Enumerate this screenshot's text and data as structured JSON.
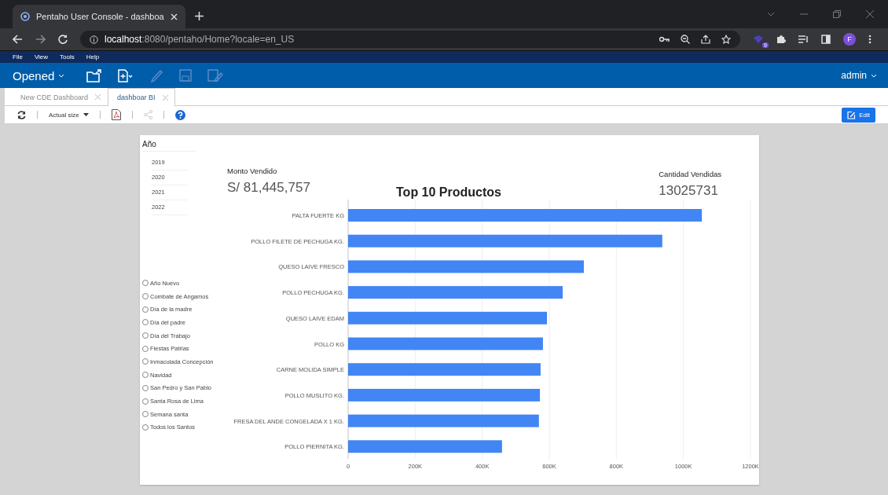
{
  "browser": {
    "tab_title": "Pentaho User Console - dashboa",
    "url_host": "localhost",
    "url_rest": ":8080/pentaho/Home?locale=en_US",
    "extension_badge": "9",
    "profile_initial": "F"
  },
  "menu": [
    "File",
    "View",
    "Tools",
    "Help"
  ],
  "toolbar": {
    "perspective": "Opened",
    "user": "admin"
  },
  "tabs": [
    {
      "label": "New CDE Dashboard",
      "selected": false
    },
    {
      "label": "dashboar BI",
      "selected": true
    }
  ],
  "viewer": {
    "zoom": "Actual size",
    "edit_button": "Edit"
  },
  "dashboard": {
    "year_filter": {
      "title": "Año",
      "years": [
        {
          "label": "2019",
          "selected": false
        },
        {
          "label": "2020",
          "selected": false
        },
        {
          "label": "2021",
          "selected": false
        },
        {
          "label": "2022",
          "selected": false
        }
      ]
    },
    "holidays": [
      {
        "label": "Año Nuevo",
        "selected": false
      },
      {
        "label": "Combate de Angamos",
        "selected": false
      },
      {
        "label": "Día de la madre",
        "selected": false
      },
      {
        "label": "Día del padre",
        "selected": false
      },
      {
        "label": "Día del Trabajo",
        "selected": false
      },
      {
        "label": "Fiestas Patrias",
        "selected": false
      },
      {
        "label": "Inmaculada Concepción",
        "selected": false
      },
      {
        "label": "Navidad",
        "selected": false
      },
      {
        "label": "San Pedro y San Pablo",
        "selected": false
      },
      {
        "label": "Santa Rosa de Lima",
        "selected": false
      },
      {
        "label": "Semana santa",
        "selected": false
      },
      {
        "label": "Todos los Santos",
        "selected": false
      }
    ],
    "kpis": [
      {
        "label": "Monto Vendido",
        "value": "S/ 81,445,757"
      },
      {
        "label": "Cantidad Vendidas",
        "value": "13025731"
      }
    ],
    "chart_data": {
      "type": "bar",
      "orientation": "horizontal",
      "title": "Top 10 Productos",
      "categories": [
        "PALTA FUERTE KG",
        "POLLO FILETE DE PECHUGA KG.",
        "QUESO LAIVE FRESCO",
        "POLLO PECHUGA KG.",
        "QUESO LAIVE EDAM",
        "POLLO KG",
        "CARNE MOLIDA SIMPLE",
        "POLLO MUSLITO KG.",
        "FRESA DEL ANDE CONGELADA X 1 KG.",
        "POLLO PIERNITA KG."
      ],
      "grid": true,
      "series": [
        {
          "color": "#4285f4",
          "values": [
            1055000,
            937000,
            703000,
            640000,
            593000,
            581000,
            574000,
            572000,
            569000,
            459000
          ]
        }
      ],
      "xlim": [
        0,
        1200000
      ],
      "xticks": [
        {
          "value": 0,
          "label": "0"
        },
        {
          "value": 200000,
          "label": "200K"
        },
        {
          "value": 400000,
          "label": "400K"
        },
        {
          "value": 600000,
          "label": "600K"
        },
        {
          "value": 800000,
          "label": "800K"
        },
        {
          "value": 1000000,
          "label": "1000K"
        },
        {
          "value": 1200000,
          "label": "1200K"
        }
      ]
    }
  }
}
